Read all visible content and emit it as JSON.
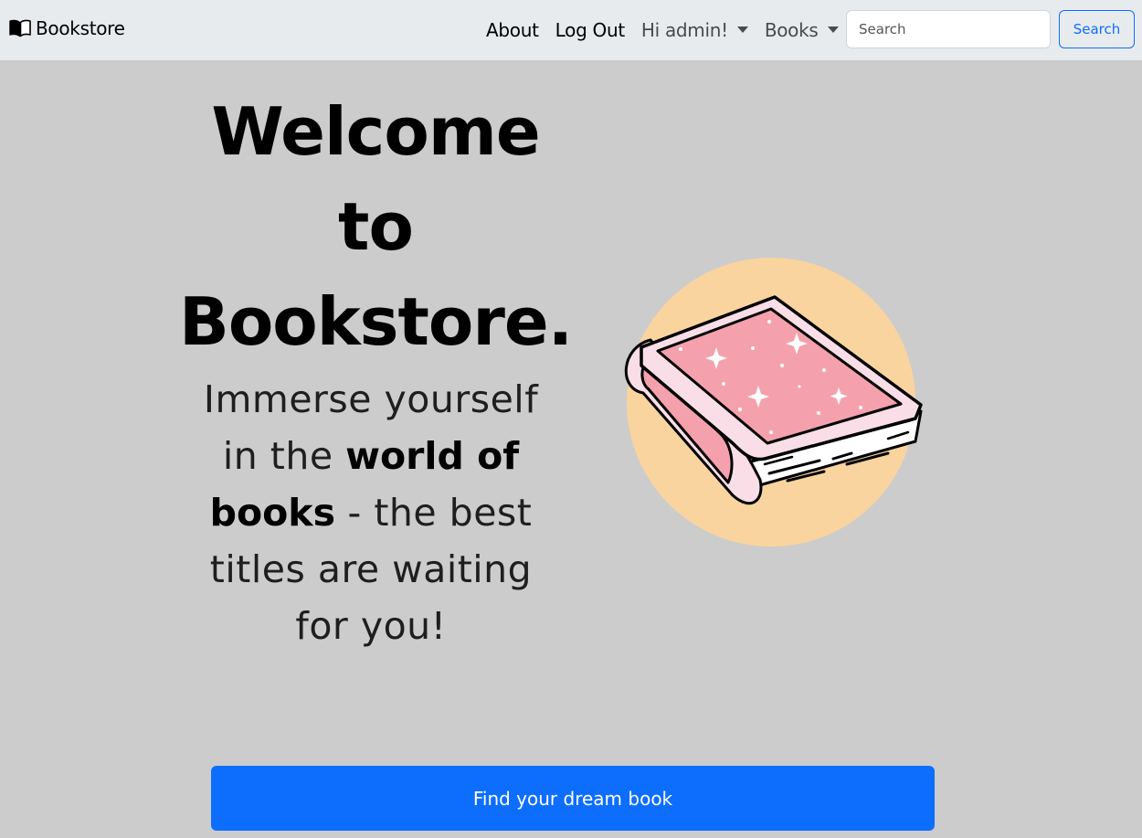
{
  "navbar": {
    "brand": "Bookstore",
    "brand_icon": "open-book-icon",
    "links": {
      "about": "About",
      "logout": "Log Out",
      "user_menu": "Hi admin!",
      "books_menu": "Books"
    },
    "search": {
      "placeholder": "Search",
      "value": "",
      "button_label": "Search"
    }
  },
  "hero": {
    "title_line1": "Welcome",
    "title_line2": "to",
    "title_line3": "Bookstore.",
    "subtitle_before": "Immerse yourself in the",
    "subtitle_bold": "world of books",
    "subtitle_after": "- the best titles are waiting for you!",
    "illustration_icon": "sparkly-pink-book-icon",
    "cta_label": "Find your dream book"
  },
  "colors": {
    "page_background": "#cccccc",
    "navbar_background": "#e8ebee",
    "primary": "#0d6efd",
    "illustration_circle": "#fad49e",
    "book_cover": "#f4a1ad",
    "book_spine_light": "#f9dde7"
  }
}
